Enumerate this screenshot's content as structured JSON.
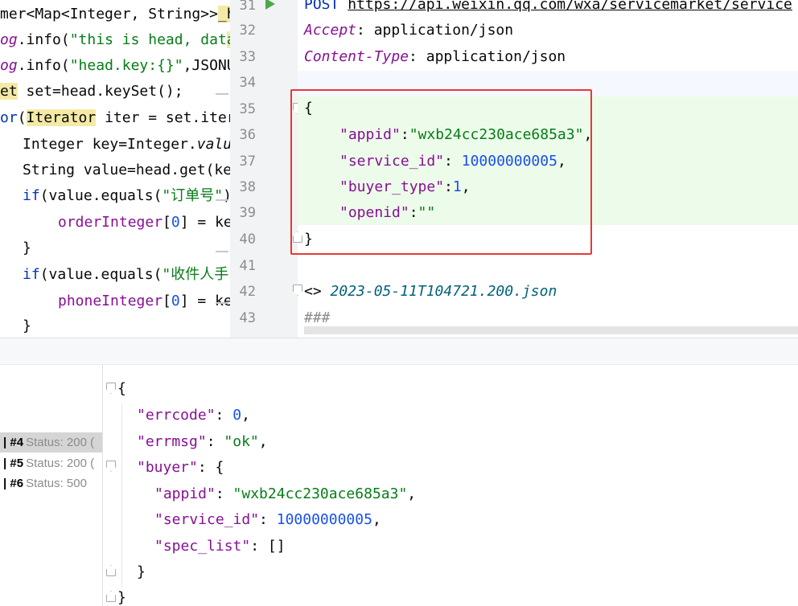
{
  "left_editor": {
    "lines": [
      {
        "a": "mer<Map<Integer, String>>",
        "b": "_h"
      },
      {
        "a": "og",
        "b": ".info(",
        "c": "\"this is head, dat",
        "d": "a"
      },
      {
        "a": "og",
        "b": ".info(",
        "c": "\"head.key:{}\"",
        "d": ",JSONU"
      },
      {
        "a": "et",
        "b": " set=head.keySet();"
      },
      {
        "a": "or",
        "b": "(",
        "c": "Iterator",
        "d": " iter = set.ite",
        "e": "r"
      },
      {
        "a": "Integer key=Integer.",
        "b": "valu"
      },
      {
        "a": "String value=head.get(k",
        "b": "e"
      },
      {
        "a": "if",
        "b": "(value.equals(",
        "c": "\"订单号\"",
        "d": ")"
      },
      {
        "a": "orderInteger",
        "b": "[",
        "c": "0",
        "d": "] = ke"
      },
      {
        "a": "}"
      },
      {
        "a": "if",
        "b": "(value.equals(",
        "c": "\"收件人手",
        "d": ""
      },
      {
        "a": "phoneInteger",
        "b": "[",
        "c": "0",
        "d": "] = ke"
      },
      {
        "a": "}"
      }
    ]
  },
  "http_editor": {
    "line_numbers": [
      "31",
      "32",
      "33",
      "34",
      "35",
      "36",
      "37",
      "38",
      "39",
      "40",
      "41",
      "42",
      "43"
    ],
    "method": "POST",
    "url": "https://api.weixin.qq.com/wxa/servicemarket/service",
    "headers": [
      {
        "name": "Accept",
        "value": "application/json"
      },
      {
        "name": "Content-Type",
        "value": "application/json"
      }
    ],
    "body_open": "{",
    "body_fields": [
      {
        "key": "\"appid\"",
        "colon": ":",
        "value": "\"wxb24cc230ace685a3\"",
        "type": "str",
        "comma": ","
      },
      {
        "key": "\"service_id\"",
        "colon": ": ",
        "value": "10000000005",
        "type": "num",
        "comma": ","
      },
      {
        "key": "\"buyer_type\"",
        "colon": ":",
        "value": "1",
        "type": "num",
        "comma": ","
      },
      {
        "key": "\"openid\"",
        "colon": ":",
        "value": "\"\"",
        "type": "str",
        "comma": ""
      }
    ],
    "body_close": "}",
    "response_ref_prefix": "<> ",
    "response_ref_file": "2023-05-11T104721.200.json",
    "separator": "###"
  },
  "history": {
    "items": [
      {
        "bar": "|",
        "num": "#4",
        "status": "Status: 200 (",
        "selected": true
      },
      {
        "bar": "|",
        "num": "#5",
        "status": "Status: 200 (",
        "selected": false
      },
      {
        "bar": "|",
        "num": "#6",
        "status": "Status: 500",
        "selected": false
      }
    ]
  },
  "response": {
    "open": "{",
    "errcode_key": "\"errcode\"",
    "errcode_val": "0",
    "errmsg_key": "\"errmsg\"",
    "errmsg_val": "\"ok\"",
    "buyer_key": "\"buyer\"",
    "buyer_open": "{",
    "appid_key": "\"appid\"",
    "appid_val": "\"wxb24cc230ace685a3\"",
    "service_id_key": "\"service_id\"",
    "service_id_val": "10000000005",
    "spec_list_key": "\"spec_list\"",
    "spec_list_val": "[]",
    "buyer_close": "}",
    "close": "}"
  },
  "colors": {
    "keyword": "#0033b3",
    "string": "#067d17",
    "number": "#1750eb",
    "json_key": "#871094",
    "highlight_box": "#e53935",
    "json_bg": "#edfbea"
  }
}
